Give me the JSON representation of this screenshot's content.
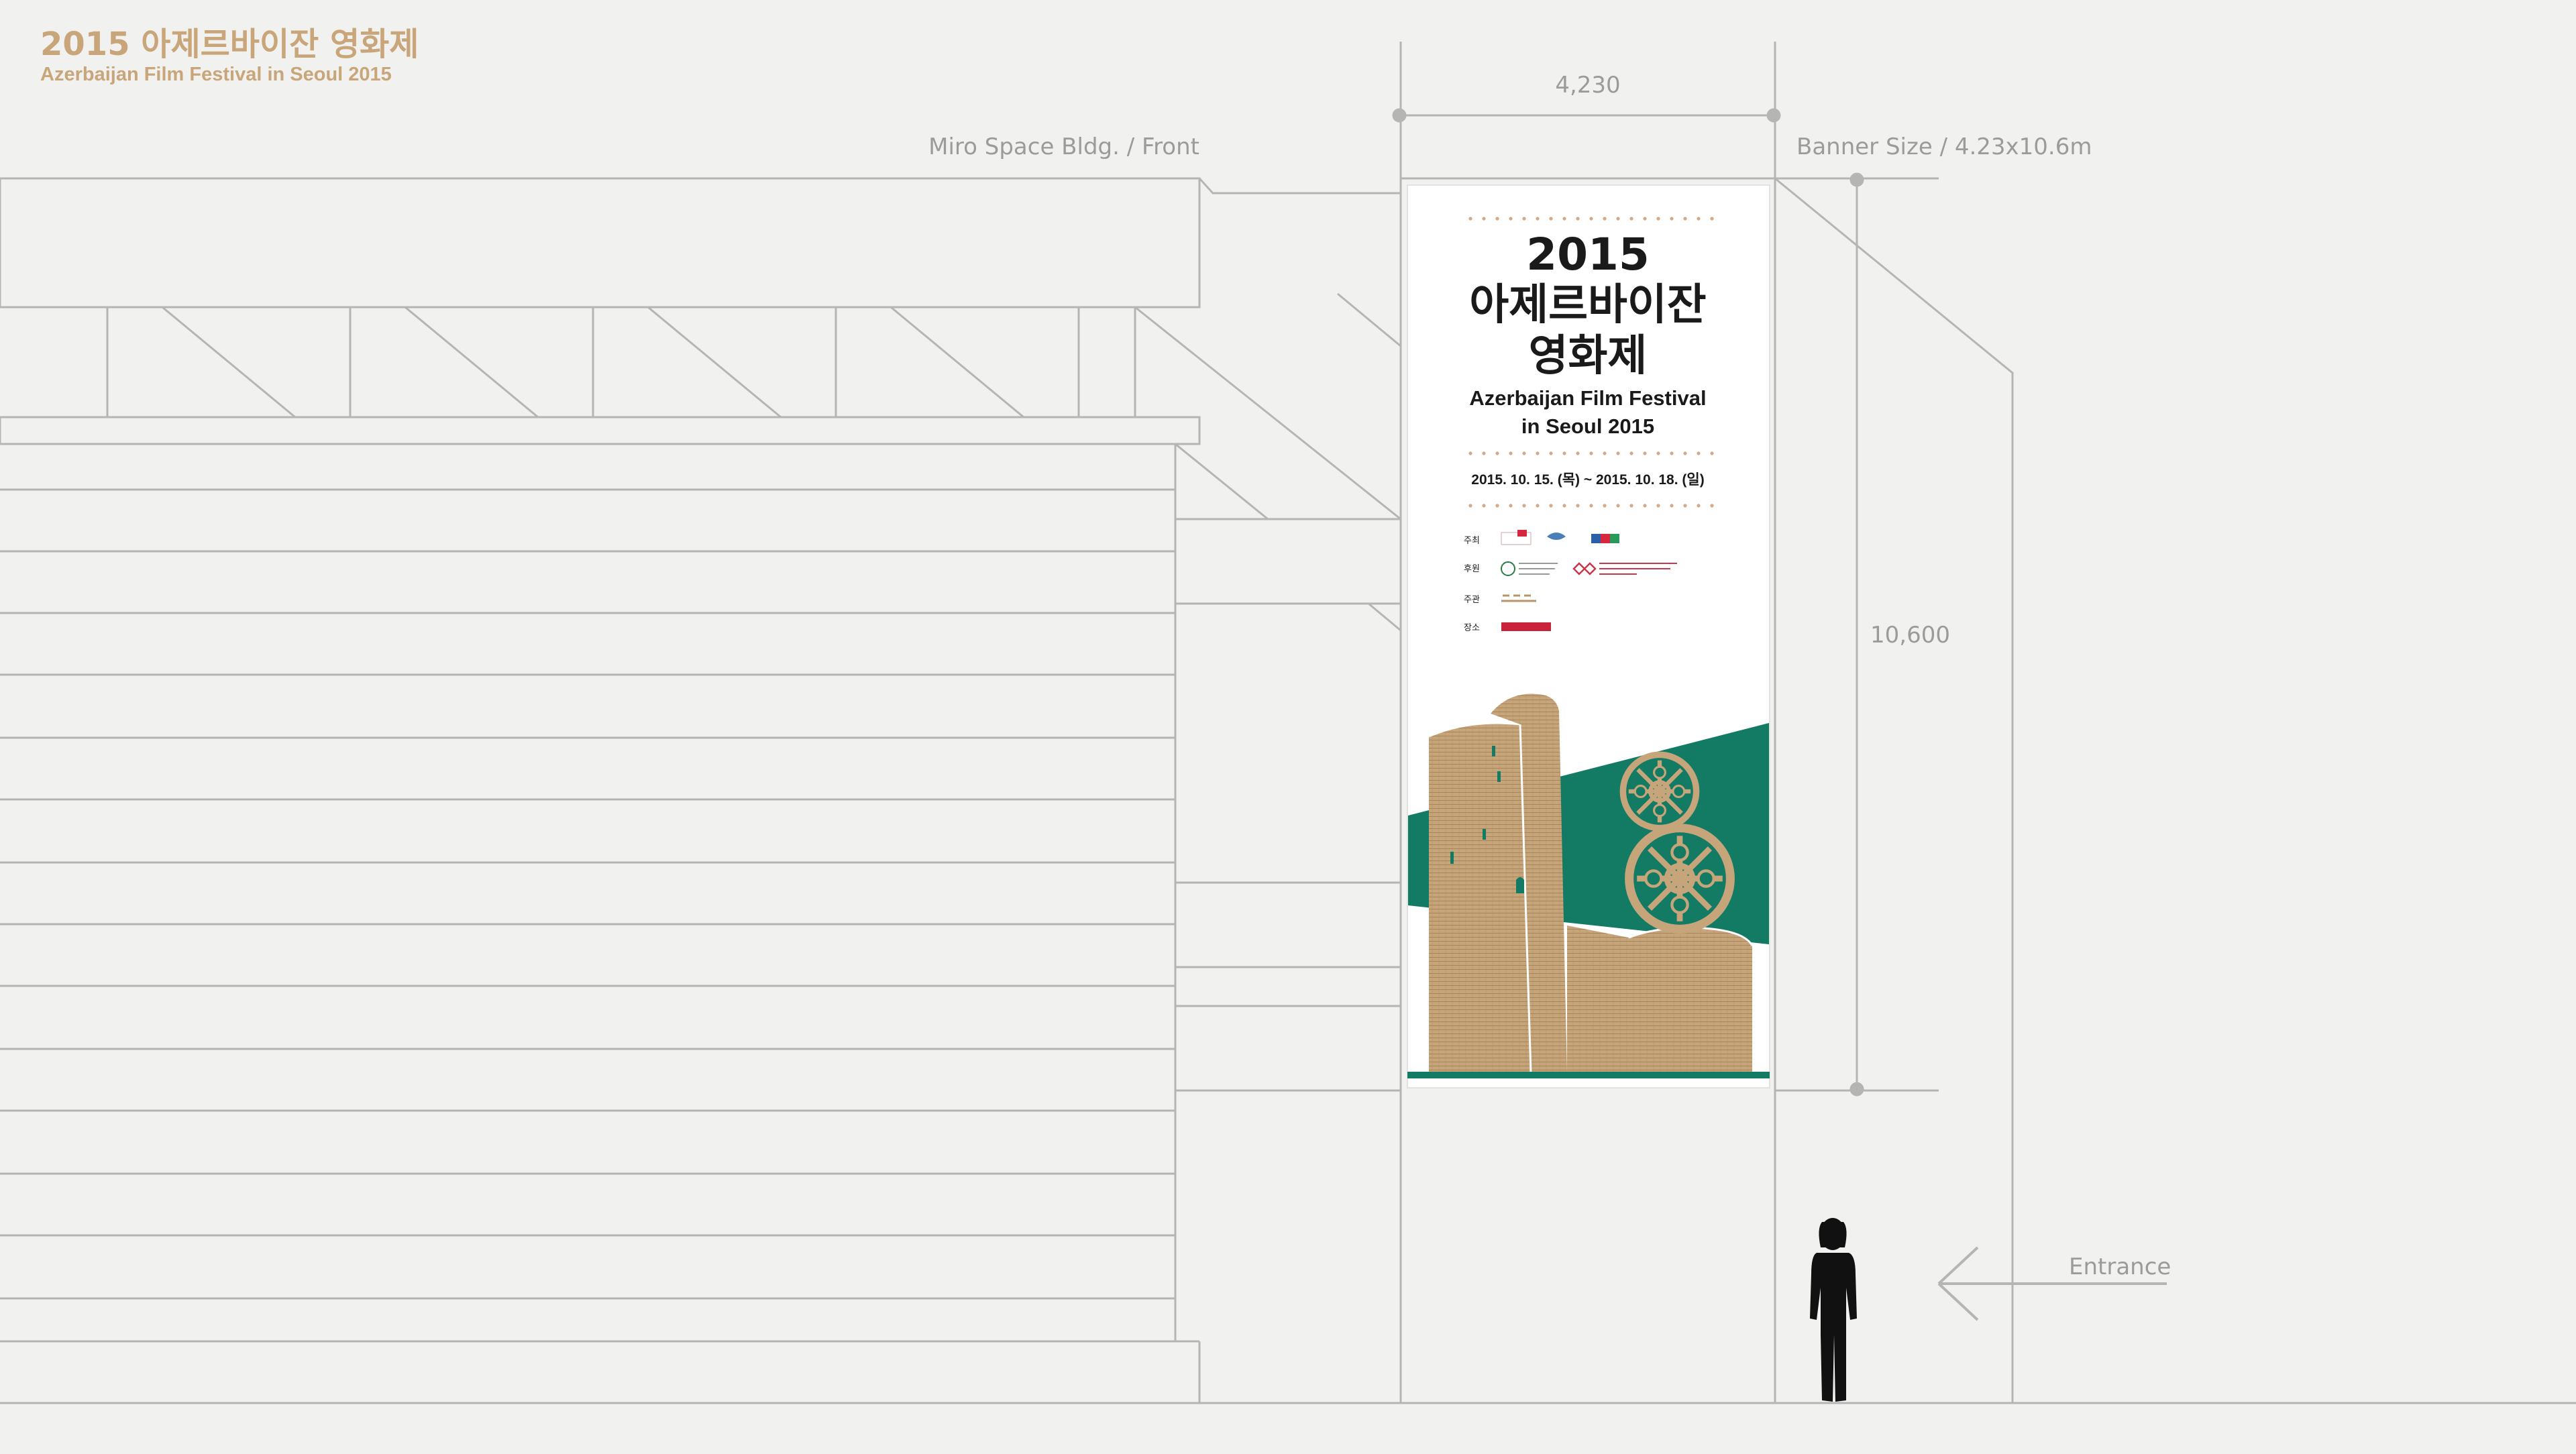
{
  "header": {
    "title_ko": "2015 아제르바이잔 영화제",
    "title_en": "Azerbaijan Film Festival in Seoul 2015"
  },
  "labels": {
    "building": "Miro Space Bldg. / Front",
    "banner_size": "Banner Size / 4.23x10.6m",
    "width_dim": "4,230",
    "height_dim": "10,600",
    "entrance": "Entrance"
  },
  "banner": {
    "year": "2015",
    "title_line1": "아제르바이잔",
    "title_line2": "영화제",
    "en_line1": "Azerbaijan Film Festival",
    "en_line2": "in Seoul 2015",
    "dates": "2015. 10. 15. (목) ~ 2015. 10. 18. (일)",
    "credits": [
      {
        "role": "주최"
      },
      {
        "role": "후원"
      },
      {
        "role": "주관"
      },
      {
        "role": "장소"
      }
    ]
  },
  "colors": {
    "background": "#f1f1ef",
    "line": "#b5b5b3",
    "accent_gold": "#c9a57a",
    "tower": "#c7a57b",
    "green": "#137a63",
    "silhouette": "#111111"
  },
  "icons": {
    "entrance_arrow": "arrow-left-icon",
    "person": "person-silhouette-icon",
    "film_reel": "film-reel-icon"
  }
}
